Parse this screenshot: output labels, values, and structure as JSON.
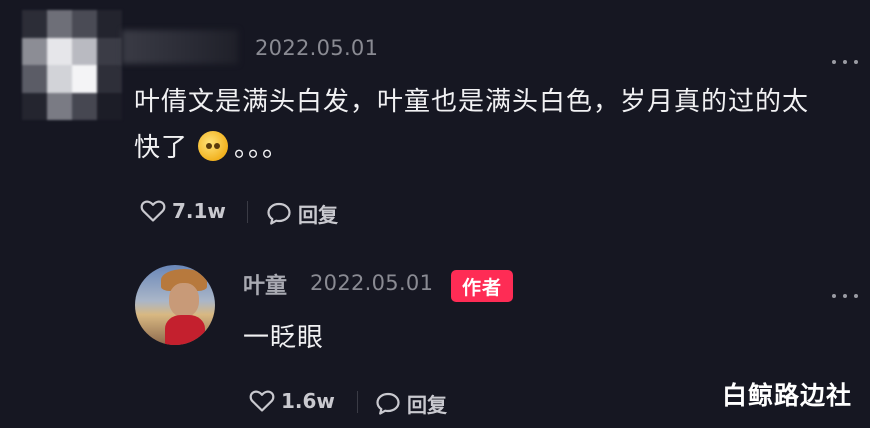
{
  "comment": {
    "timestamp": "2022.05.01",
    "text_line1": "叶倩文是满头白发，叶童也是满头白色，岁月真的过的太",
    "text_line2_before_emoji": "快了",
    "text_line2_after_emoji": "。。。",
    "emoji_icon": "pleading-face-icon",
    "like_count": "7.1w",
    "reply_label": "回复"
  },
  "reply": {
    "author_name": "叶童",
    "timestamp": "2022.05.01",
    "author_badge": "作者",
    "text": "一眨眼",
    "like_count": "1.6w",
    "reply_label": "回复"
  },
  "watermark": "白鲸路边社",
  "colors": {
    "background": "#161722",
    "badge": "#fe2c55",
    "text_primary": "#f1f1f3",
    "text_secondary": "#8a8b93"
  }
}
